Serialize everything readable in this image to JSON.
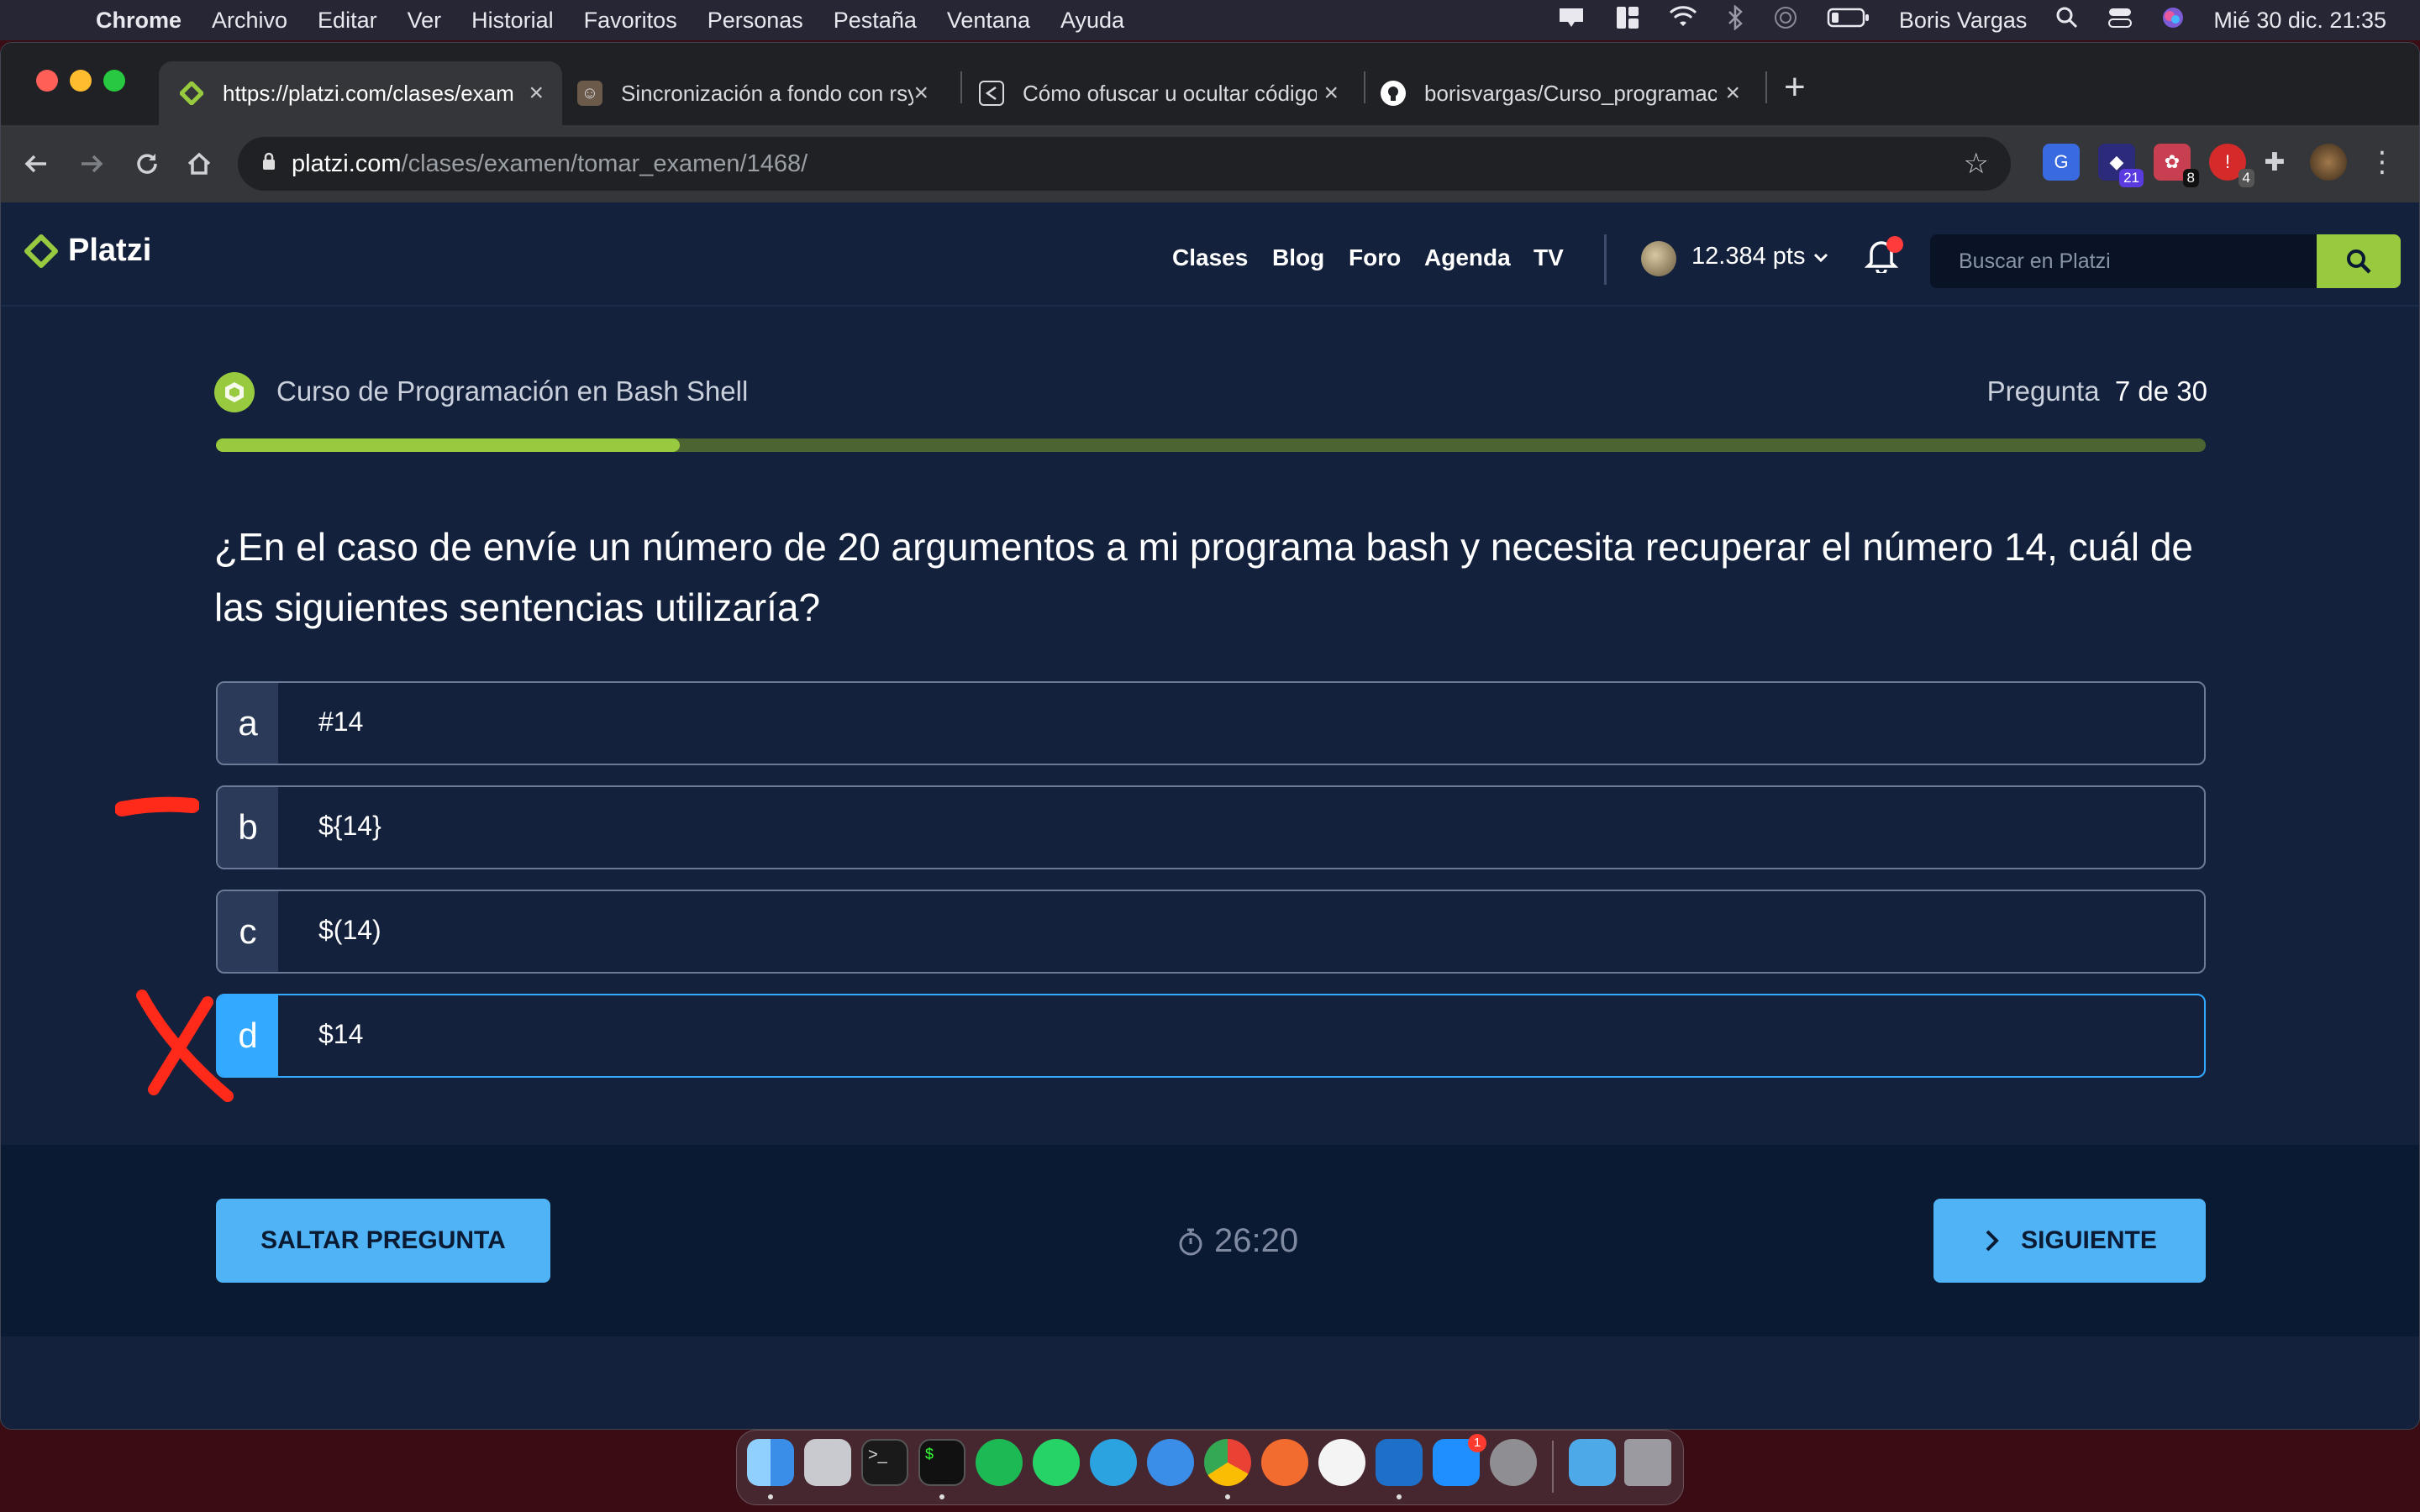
{
  "menubar": {
    "app": "Chrome",
    "items": [
      "Archivo",
      "Editar",
      "Ver",
      "Historial",
      "Favoritos",
      "Personas",
      "Pestaña",
      "Ventana",
      "Ayuda"
    ],
    "user": "Boris Vargas",
    "datetime": "Mié 30 dic.  21:35"
  },
  "tabs": [
    {
      "title": "https://platzi.com/clases/exam",
      "icon": "platzi-icon"
    },
    {
      "title": "Sincronización a fondo con rsy",
      "icon": "avatar-icon"
    },
    {
      "title": "Cómo ofuscar u ocultar código",
      "icon": "share-icon"
    },
    {
      "title": "borisvargas/Curso_programaci",
      "icon": "github-icon"
    }
  ],
  "omnibox": {
    "domain": "platzi.com",
    "path": "/clases/examen/tomar_examen/1468/"
  },
  "extensions": {
    "badge1": "21",
    "badge2": "8",
    "badge3": "4"
  },
  "header": {
    "brand": "Platzi",
    "nav": [
      "Clases",
      "Blog",
      "Foro",
      "Agenda",
      "TV"
    ],
    "points": "12.384 pts",
    "search_placeholder": "Buscar en Platzi"
  },
  "exam": {
    "course": "Curso de Programación en Bash Shell",
    "question_label": "Pregunta",
    "question_count": "7 de 30",
    "progress": 0.233,
    "question": "¿En el caso de envíe un número de 20 argumentos a mi programa bash y necesita recuperar el número 14, cuál de las siguientes sentencias utilizaría?",
    "options": [
      {
        "letter": "a",
        "text": "#14"
      },
      {
        "letter": "b",
        "text": "${14}"
      },
      {
        "letter": "c",
        "text": "$(14)"
      },
      {
        "letter": "d",
        "text": "$14",
        "selected": true
      }
    ],
    "skip_label": "SALTAR PREGUNTA",
    "timer": "26:20",
    "next_label": "SIGUIENTE"
  },
  "dock_badge": "1",
  "colors": {
    "accent_green": "#98ca3f",
    "accent_blue": "#4fb3f6",
    "bg": "#13213c",
    "annotation_red": "#ff2a1a"
  }
}
